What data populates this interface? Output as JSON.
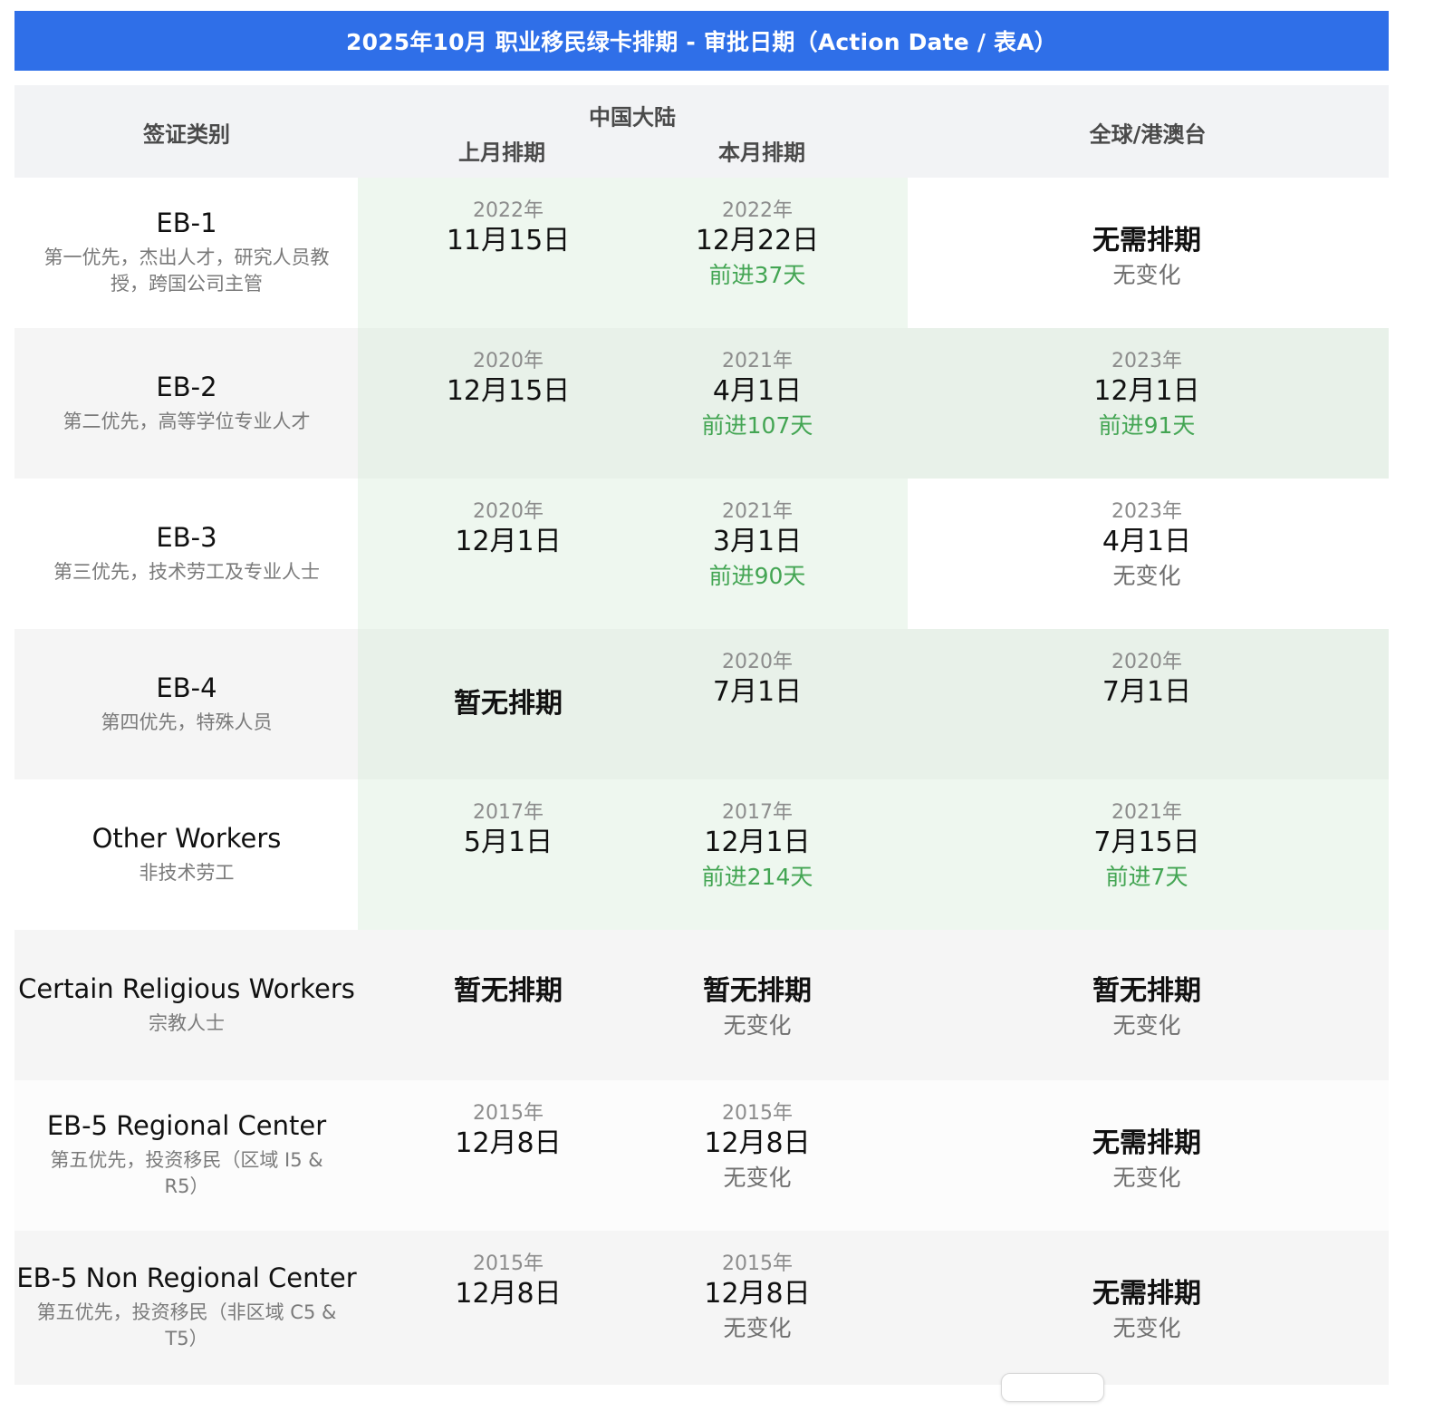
{
  "title": "2025年10月 职业移民绿卡排期 - 审批日期（Action Date / 表A）",
  "headers": {
    "category": "签证类别",
    "china_group": "中国大陆",
    "prev_month": "上月排期",
    "this_month": "本月排期",
    "global": "全球/港澳台"
  },
  "rows": [
    {
      "name": "EB-1",
      "desc": "第一优先，杰出人才，研究人员教授，跨国公司主管",
      "prev": {
        "year": "2022年",
        "date": "11月15日"
      },
      "curr": {
        "year": "2022年",
        "date": "12月22日",
        "change": "前进37天"
      },
      "global": {
        "main": "无需排期",
        "change": "无变化"
      }
    },
    {
      "name": "EB-2",
      "desc": "第二优先，高等学位专业人才",
      "prev": {
        "year": "2020年",
        "date": "12月15日"
      },
      "curr": {
        "year": "2021年",
        "date": "4月1日",
        "change": "前进107天"
      },
      "global": {
        "year": "2023年",
        "date": "12月1日",
        "change": "前进91天"
      }
    },
    {
      "name": "EB-3",
      "desc": "第三优先，技术劳工及专业人士",
      "prev": {
        "year": "2020年",
        "date": "12月1日"
      },
      "curr": {
        "year": "2021年",
        "date": "3月1日",
        "change": "前进90天"
      },
      "global": {
        "year": "2023年",
        "date": "4月1日",
        "change": "无变化"
      }
    },
    {
      "name": "EB-4",
      "desc": "第四优先，特殊人员",
      "prev": {
        "main": "暂无排期"
      },
      "curr": {
        "year": "2020年",
        "date": "7月1日"
      },
      "global": {
        "year": "2020年",
        "date": "7月1日"
      }
    },
    {
      "name": "Other Workers",
      "desc": "非技术劳工",
      "prev": {
        "year": "2017年",
        "date": "5月1日"
      },
      "curr": {
        "year": "2017年",
        "date": "12月1日",
        "change": "前进214天"
      },
      "global": {
        "year": "2021年",
        "date": "7月15日",
        "change": "前进7天"
      }
    },
    {
      "name": "Certain Religious Workers",
      "desc": "宗教人士",
      "prev": {
        "main": "暂无排期"
      },
      "curr": {
        "main": "暂无排期",
        "change": "无变化"
      },
      "global": {
        "main": "暂无排期",
        "change": "无变化"
      }
    },
    {
      "name": "EB-5 Regional Center",
      "desc": "第五优先，投资移民（区域 I5 & R5）",
      "prev": {
        "year": "2015年",
        "date": "12月8日"
      },
      "curr": {
        "year": "2015年",
        "date": "12月8日",
        "change": "无变化"
      },
      "global": {
        "main": "无需排期",
        "change": "无变化"
      }
    },
    {
      "name": "EB-5 Non Regional Center",
      "desc": "第五优先，投资移民（非区域 C5 & T5）",
      "prev": {
        "year": "2015年",
        "date": "12月8日"
      },
      "curr": {
        "year": "2015年",
        "date": "12月8日",
        "change": "无变化"
      },
      "global": {
        "main": "无需排期",
        "change": "无变化"
      }
    }
  ],
  "colors": {
    "title_bg": "#2f6fe8",
    "header_bg": "#f2f3f5",
    "green_text": "#43a553",
    "light_green": "#eef7ef",
    "mid_green": "#e8f1e9",
    "row_gray": "#f5f5f5",
    "row_white": "#ffffff"
  }
}
